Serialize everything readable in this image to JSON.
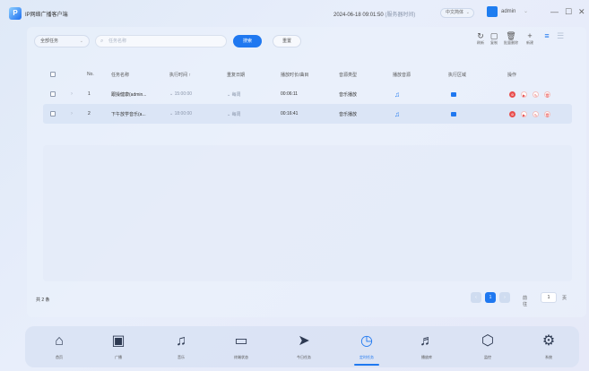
{
  "app": {
    "title": "IP网络广播客户端",
    "logo_glyph": "P"
  },
  "header": {
    "datetime": "2024-06-18 09:01:50",
    "datetime_note": "(服务器时间)",
    "language": "中文简体",
    "user": "admin"
  },
  "toolbar": {
    "scope_value": "全部任务",
    "search_placeholder": "任务名称",
    "search_label": "搜索",
    "reset_label": "重置",
    "tools": [
      {
        "icon": "refresh-icon",
        "glyph": "↻",
        "label": "刷新"
      },
      {
        "icon": "copy-icon",
        "glyph": "▢",
        "label": "复制"
      },
      {
        "icon": "trash-icon",
        "glyph": "🗑",
        "label": "批量删除"
      },
      {
        "icon": "plus-icon",
        "glyph": "+",
        "label": "新建"
      },
      {
        "icon": "list-view-icon",
        "glyph": "≡",
        "label": ""
      },
      {
        "icon": "grid-view-icon",
        "glyph": "☰",
        "label": ""
      }
    ]
  },
  "table": {
    "columns": [
      "No.",
      "任务名称",
      "执行时间 ↑",
      "重复日期",
      "播放时长/曲目",
      "音源类型",
      "播放音源",
      "执行区域",
      "操作"
    ],
    "rows": [
      {
        "no": "1",
        "name": "跟操健康(admin...",
        "time": "15:00:00",
        "repeat": "每周",
        "duration": "00:06:11",
        "source_type": "音乐播放"
      },
      {
        "no": "2",
        "name": "下午放学音乐(a...",
        "time": "18:00:00",
        "repeat": "每周",
        "duration": "00:16:41",
        "source_type": "音乐播放"
      }
    ]
  },
  "footer": {
    "total": "共 2 条",
    "current_page": "1",
    "goto_label": "前往",
    "goto_value": "1",
    "goto_suffix": "页"
  },
  "nav": [
    {
      "icon": "home-icon",
      "glyph": "⌂",
      "label": "首页"
    },
    {
      "icon": "broadcast-icon",
      "glyph": "▣",
      "label": "广播"
    },
    {
      "icon": "music-icon",
      "glyph": "♫",
      "label": "音乐"
    },
    {
      "icon": "device-status-icon",
      "glyph": "▭",
      "label": "终端状态"
    },
    {
      "icon": "today-task-icon",
      "glyph": "➤",
      "label": "今日任务"
    },
    {
      "icon": "timer-task-icon",
      "glyph": "◷",
      "label": "定时任务",
      "active": true
    },
    {
      "icon": "library-icon",
      "glyph": "♬",
      "label": "播放库"
    },
    {
      "icon": "monitor-icon",
      "glyph": "⬡",
      "label": "监控"
    },
    {
      "icon": "settings-icon",
      "glyph": "⚙",
      "label": "系统"
    }
  ],
  "colors": {
    "accent": "#1f78f0",
    "danger": "#e84e4e"
  }
}
